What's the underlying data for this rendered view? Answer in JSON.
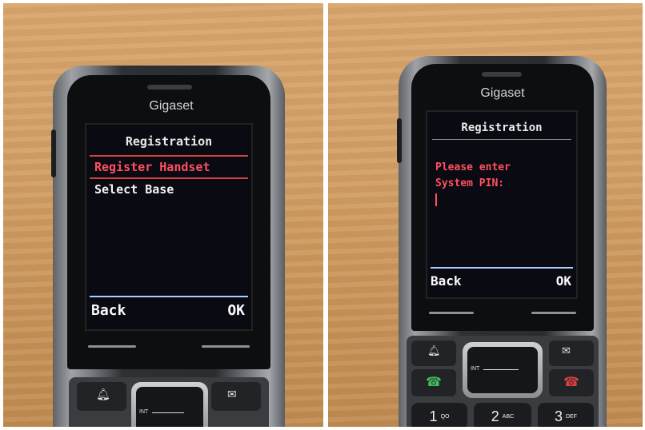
{
  "left_photo": {
    "brand": "Gigaset",
    "screen": {
      "title": "Registration",
      "items": [
        {
          "label": "Register Handset",
          "selected": true
        },
        {
          "label": "Select Base",
          "selected": false
        }
      ],
      "soft_left": "Back",
      "soft_right": "OK"
    },
    "keys": {
      "nav_int": "INT"
    }
  },
  "right_photo": {
    "brand": "Gigaset",
    "screen": {
      "title": "Registration",
      "prompt_line1": "Please enter",
      "prompt_line2": "System PIN:",
      "soft_left": "Back",
      "soft_right": "OK"
    },
    "keys": {
      "nav_int": "INT",
      "k1": "1",
      "k1_sub": "QO",
      "k2": "2",
      "k2_sub": "ABC",
      "k3": "3",
      "k3_sub": "DEF"
    }
  },
  "colors": {
    "selected_text": "#ff5060",
    "table_wood": "#d3a066",
    "phone_body": "#2a2c30"
  }
}
